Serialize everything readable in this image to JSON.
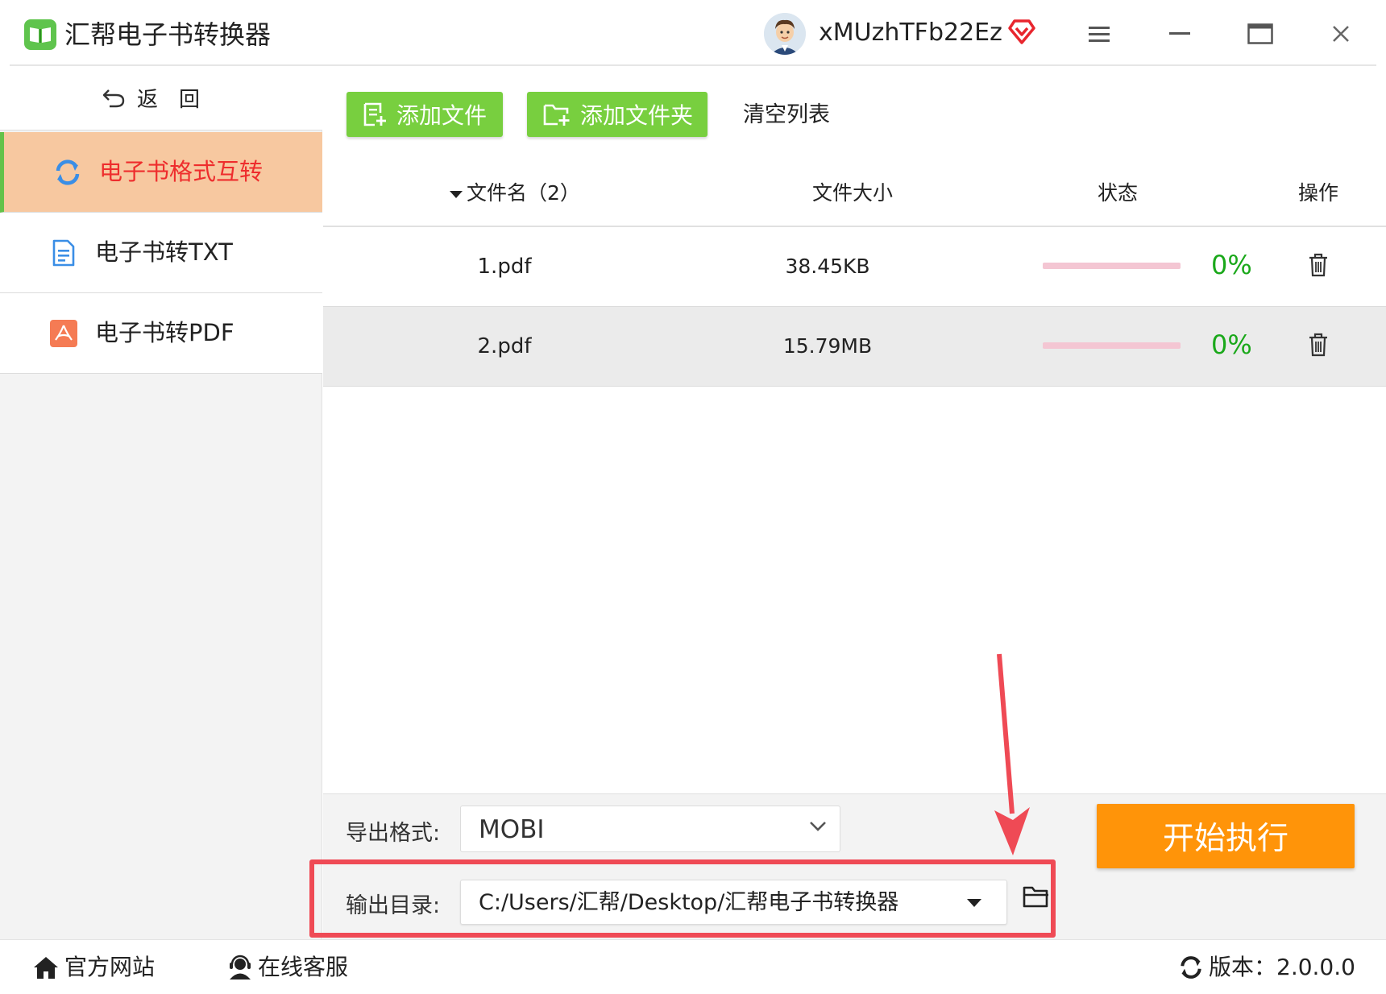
{
  "app": {
    "title": "汇帮电子书转换器",
    "logo_icon": "open-book-icon",
    "brand_color": "#5fc44d"
  },
  "user": {
    "name": "xMUzhTFb22Ez",
    "vip_icon": "vip-diamond-icon"
  },
  "window_controls": {
    "menu": "menu-icon",
    "minimize": "minimize-icon",
    "maximize": "maximize-icon",
    "close": "close-icon"
  },
  "sidebar": {
    "back": {
      "label": "返回",
      "icon": "undo-arrow-icon"
    },
    "items": [
      {
        "label": "电子书格式互转",
        "icon": "refresh-icon",
        "active": true
      },
      {
        "label": "电子书转TXT",
        "icon": "text-document-icon",
        "active": false
      },
      {
        "label": "电子书转PDF",
        "icon": "pdf-icon",
        "active": false
      }
    ]
  },
  "toolbar": {
    "add_file": "添加文件",
    "add_folder": "添加文件夹",
    "clear_list": "清空列表"
  },
  "table": {
    "columns": {
      "name": "文件名（2）",
      "size": "文件大小",
      "status": "状态",
      "action": "操作"
    },
    "rows": [
      {
        "name": "1.pdf",
        "size": "38.45KB",
        "progress": 0,
        "progress_text": "0%"
      },
      {
        "name": "2.pdf",
        "size": "15.79MB",
        "progress": 0,
        "progress_text": "0%"
      }
    ]
  },
  "output": {
    "format_label": "导出格式:",
    "format_value": "MOBI",
    "dir_label": "输出目录:",
    "dir_value": "C:/Users/汇帮/Desktop/汇帮电子书转换器",
    "start_label": "开始执行"
  },
  "footer": {
    "website": "官方网站",
    "support": "在线客服",
    "version": "版本：2.0.0.0"
  },
  "colors": {
    "accent_green": "#78cf3f",
    "start_orange": "#ff9409",
    "active_nav_bg": "#f7c8a0",
    "active_nav_text": "#ee2d2d",
    "progress_green": "#1aa81a",
    "annotation_red": "#ef4a55"
  }
}
